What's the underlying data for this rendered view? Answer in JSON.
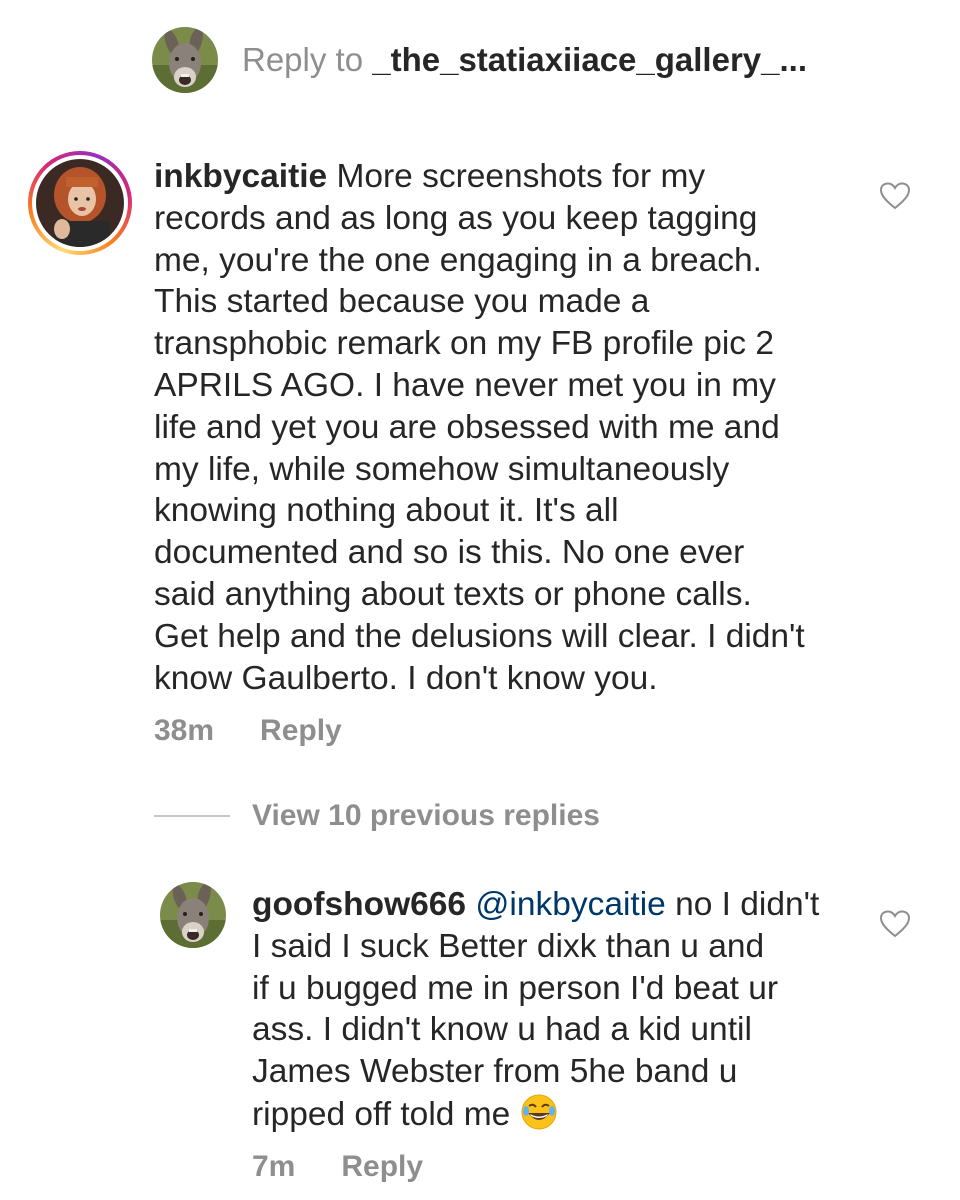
{
  "reply_bar": {
    "prefix": "Reply to ",
    "handle": "_the_statiaxiiace_gallery_..."
  },
  "comments": [
    {
      "username": "inkbycaitie",
      "text": " More screenshots for my\nrecords and as long as you keep tagging\nme, you're the one engaging in a breach.\nThis started because you made a\ntransphobic remark on my FB profile pic 2\nAPRILS AGO. I have never met you in my\nlife and yet you are obsessed with me and\nmy life, while somehow simultaneously\nknowing nothing about it. It's all\ndocumented and so is this. No one ever\nsaid anything about texts or phone calls.\nGet help and the delusions will clear. I didn't\nknow Gaulberto. I don't know you.",
      "time": "38m",
      "reply_label": "Reply",
      "avatar_icon": "profile-photo-woman",
      "like_icon": "heart-outline-icon"
    },
    {
      "username": "goofshow666",
      "mention": "@inkbycaitie",
      "text": " no I didn't\nI said I suck Better dixk than u and\nif u bugged me in person I'd beat  ur\nass. I didn't know u had a kid until\nJames Webster from 5he band u\nripped off told me ",
      "emoji": "😂",
      "time": "7m",
      "reply_label": "Reply",
      "avatar_icon": "profile-photo-donkey",
      "like_icon": "heart-outline-icon"
    }
  ],
  "view_replies": {
    "label": "View 10 previous replies"
  },
  "colors": {
    "text": "#262626",
    "secondary": "#8e8e8e",
    "mention": "#00376b",
    "ring_start": "#feda75",
    "ring_end": "#962fbf"
  }
}
